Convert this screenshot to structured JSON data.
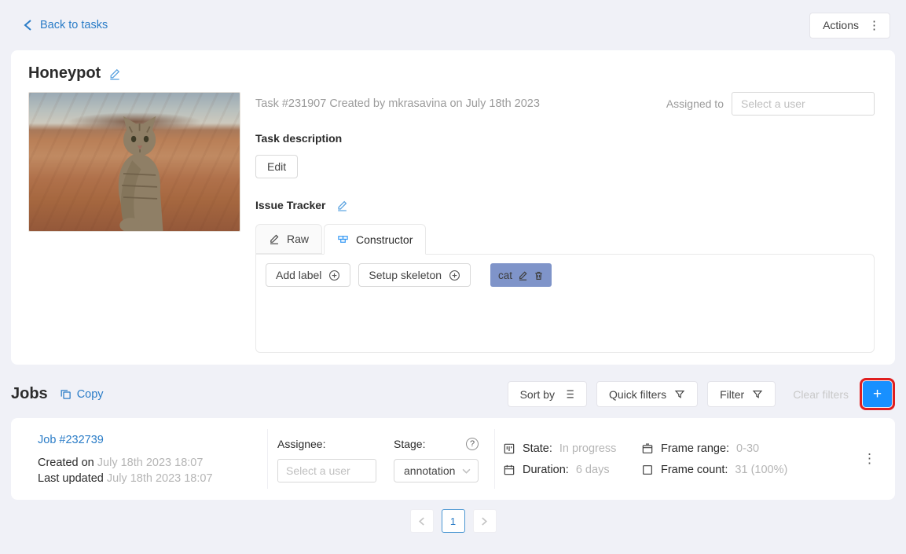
{
  "colors": {
    "accent": "#1890ff",
    "link": "#2a7cc7",
    "label_cat_chip": "#7f94c9",
    "highlight_red": "#e01f1f"
  },
  "topbar": {
    "back": "Back to tasks",
    "actions": "Actions"
  },
  "task": {
    "title": "Honeypot",
    "meta": "Task #231907 Created by mkrasavina on July 18th 2023",
    "assigned_to": "Assigned to",
    "assignee_placeholder": "Select a user",
    "description_heading": "Task description",
    "edit": "Edit",
    "issue_tracker": "Issue Tracker",
    "tabs": [
      {
        "label": "Raw"
      },
      {
        "label": "Constructor"
      }
    ],
    "constructor": {
      "add_label": "Add label",
      "setup_skeleton": "Setup skeleton",
      "labels": [
        {
          "name": "cat"
        }
      ]
    }
  },
  "jobs": {
    "heading": "Jobs",
    "copy": "Copy",
    "sort_by": "Sort by",
    "quick_filters": "Quick filters",
    "filter": "Filter",
    "clear_filters": "Clear filters",
    "add_job": "+",
    "job": {
      "id": "Job #232739",
      "created_label": "Created on",
      "created": "July 18th 2023 18:07",
      "updated_label": "Last updated",
      "updated": "July 18th 2023 18:07",
      "assignee_label": "Assignee:",
      "assignee_placeholder": "Select a user",
      "stage_label": "Stage:",
      "stage": "annotation",
      "state_label": "State:",
      "state": "In progress",
      "duration_label": "Duration:",
      "duration": "6 days",
      "frame_range_label": "Frame range:",
      "frame_range": "0-30",
      "frame_count_label": "Frame count:",
      "frame_count": "31 (100%)"
    },
    "pagination": {
      "current": "1"
    }
  }
}
